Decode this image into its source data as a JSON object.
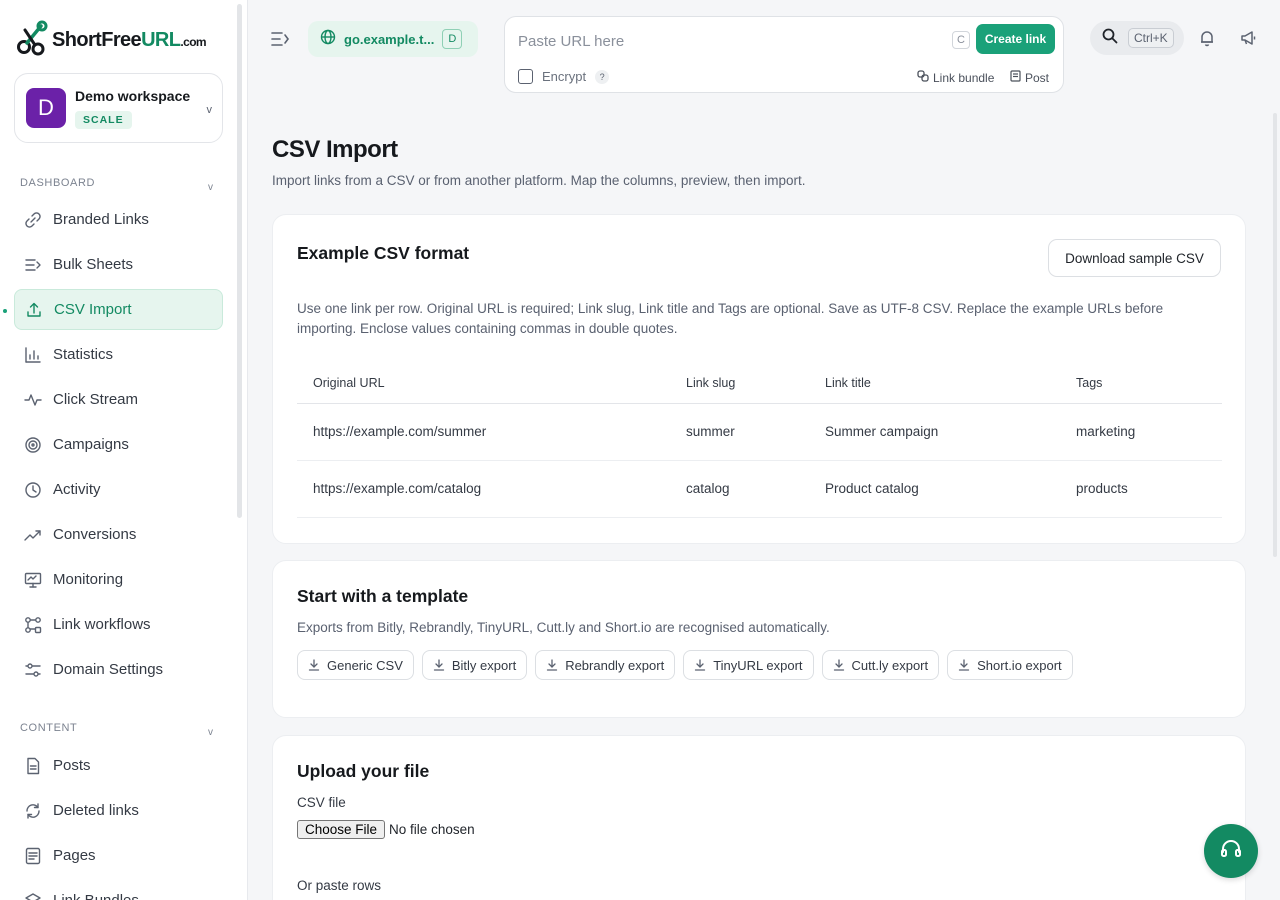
{
  "brand": {
    "logo_main": "ShortFree",
    "logo_hl": "URL",
    "logo_dom": ".com"
  },
  "workspace": {
    "initial": "D",
    "name": "Demo workspace",
    "plan": "SCALE"
  },
  "sidebar": {
    "dashboard_header": "DASHBOARD",
    "dashboard_items": [
      {
        "label": "Branded Links",
        "icon": "link-icon"
      },
      {
        "label": "Bulk Sheets",
        "icon": "list-icon"
      },
      {
        "label": "CSV Import",
        "icon": "upload-icon",
        "active": true
      },
      {
        "label": "Statistics",
        "icon": "bar-chart-icon"
      },
      {
        "label": "Click Stream",
        "icon": "pulse-icon"
      },
      {
        "label": "Campaigns",
        "icon": "target-icon"
      },
      {
        "label": "Activity",
        "icon": "clock-icon"
      },
      {
        "label": "Conversions",
        "icon": "trend-icon"
      },
      {
        "label": "Monitoring",
        "icon": "monitor-icon"
      },
      {
        "label": "Link workflows",
        "icon": "workflow-icon"
      },
      {
        "label": "Domain Settings",
        "icon": "sliders-icon"
      }
    ],
    "content_header": "CONTENT",
    "content_items": [
      {
        "label": "Posts",
        "icon": "document-icon"
      },
      {
        "label": "Deleted links",
        "icon": "refresh-icon"
      },
      {
        "label": "Pages",
        "icon": "pages-icon"
      },
      {
        "label": "Link Bundles",
        "icon": "layers-icon"
      }
    ]
  },
  "topbar": {
    "domain": "go.example.t...",
    "domain_badge": "D",
    "url_placeholder": "Paste URL here",
    "shortcut_key": "C",
    "create_label": "Create link",
    "encrypt_label": "Encrypt",
    "help_mark": "?",
    "link_bundle_label": "Link bundle",
    "post_label": "Post",
    "search_shortcut": "Ctrl+K"
  },
  "page": {
    "title": "CSV Import",
    "subtitle": "Import links from a CSV or from another platform. Map the columns, preview, then import."
  },
  "example_card": {
    "title": "Example CSV format",
    "download_label": "Download sample CSV",
    "description": "Use one link per row. Original URL is required; Link slug, Link title and Tags are optional. Save as UTF-8 CSV. Replace the example URLs before importing. Enclose values containing commas in double quotes.",
    "columns": [
      "Original URL",
      "Link slug",
      "Link title",
      "Tags"
    ],
    "rows": [
      [
        "https://example.com/summer",
        "summer",
        "Summer campaign",
        "marketing"
      ],
      [
        "https://example.com/catalog",
        "catalog",
        "Product catalog",
        "products"
      ]
    ]
  },
  "template_card": {
    "title": "Start with a template",
    "subtitle": "Exports from Bitly, Rebrandly, TinyURL, Cutt.ly and Short.io are recognised automatically.",
    "templates": [
      "Generic CSV",
      "Bitly export",
      "Rebrandly export",
      "TinyURL export",
      "Cutt.ly export",
      "Short.io export"
    ]
  },
  "upload_card": {
    "title": "Upload your file",
    "file_label": "CSV file",
    "choose_label": "Choose File",
    "no_file": "No file chosen",
    "paste_label": "Or paste rows"
  },
  "colors": {
    "accent": "#1aa179",
    "accent_dark": "#138a62",
    "accent_bg": "#e6f5ee",
    "workspace_avatar": "#6b21a8"
  }
}
